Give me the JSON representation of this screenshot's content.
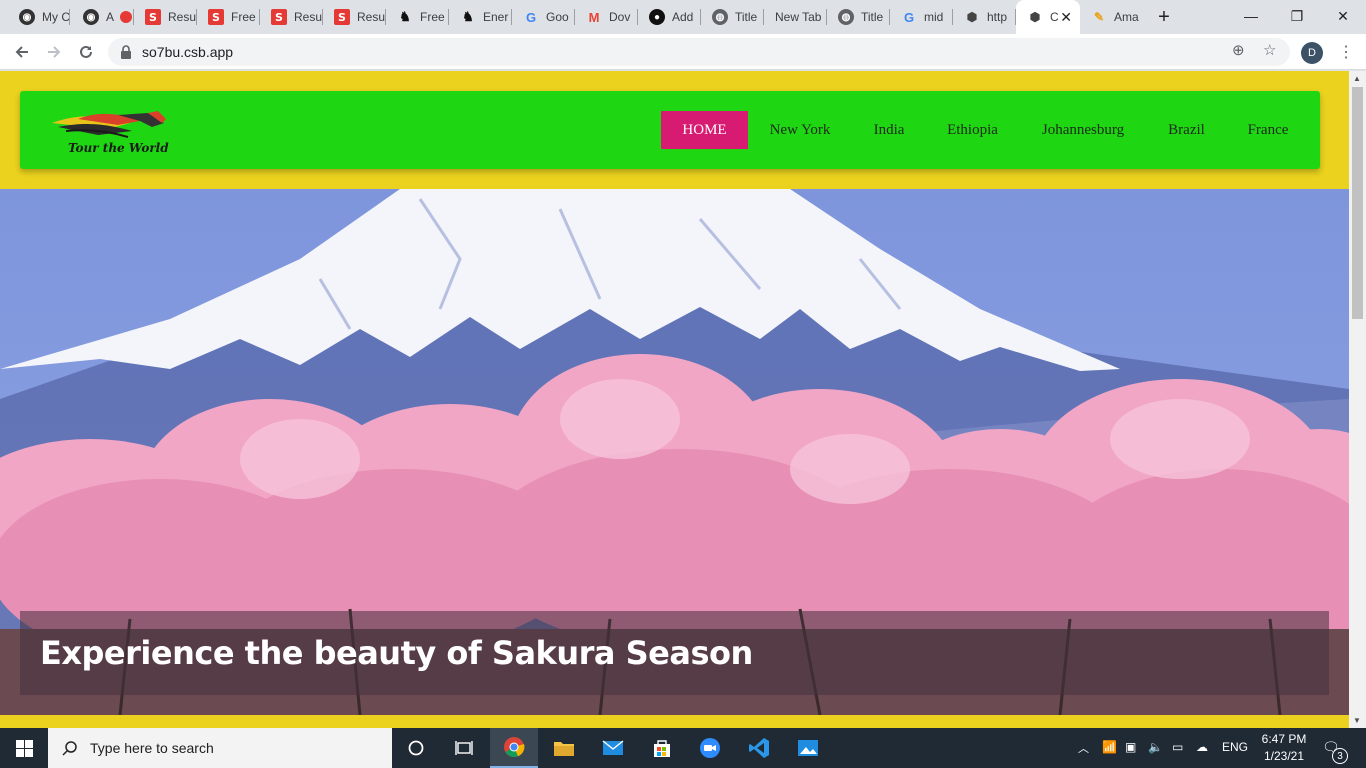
{
  "browser": {
    "tabs": [
      {
        "title": "My C",
        "favicon": "codesandbox-dark-icon"
      },
      {
        "title": "A",
        "favicon": "recording-icon"
      },
      {
        "title": "Resu",
        "favicon": "s-logo-icon"
      },
      {
        "title": "Free",
        "favicon": "s-logo-icon"
      },
      {
        "title": "Resu",
        "favicon": "s-logo-icon"
      },
      {
        "title": "Resu",
        "favicon": "s-logo-icon"
      },
      {
        "title": "Free",
        "favicon": "dark-horse-icon"
      },
      {
        "title": "Ener",
        "favicon": "dark-horse-icon"
      },
      {
        "title": "Goo",
        "favicon": "google-icon"
      },
      {
        "title": "Dov",
        "favicon": "gmail-icon"
      },
      {
        "title": "Add",
        "favicon": "github-icon"
      },
      {
        "title": "Title",
        "favicon": "globe-icon"
      },
      {
        "title": "New Tab",
        "favicon": ""
      },
      {
        "title": "Title",
        "favicon": "globe-icon"
      },
      {
        "title": "mid",
        "favicon": "google-icon"
      },
      {
        "title": "http",
        "favicon": "codesandbox-icon"
      },
      {
        "title": "C",
        "favicon": "codesandbox-icon",
        "active": true
      },
      {
        "title": "Ama",
        "favicon": "pencil-icon"
      }
    ],
    "new_tab_symbol": "+",
    "window_controls": {
      "minimize": "—",
      "maximize": "❐",
      "close": "✕"
    },
    "url": "so7bu.csb.app",
    "profile_initial": "D"
  },
  "site": {
    "logo_text": "Tour the World",
    "nav": [
      {
        "label": "HOME",
        "active": true
      },
      {
        "label": "New York"
      },
      {
        "label": "India"
      },
      {
        "label": "Ethiopia"
      },
      {
        "label": "Johannesburg"
      },
      {
        "label": "Brazil"
      },
      {
        "label": "France"
      }
    ],
    "hero_caption": "Experience the beauty of Sakura Season",
    "colors": {
      "page_background": "#ead21e",
      "navbar": "#1fd612",
      "active_nav": "#d81b72"
    }
  },
  "taskbar": {
    "search_placeholder": "Type here to search",
    "time": "6:47 PM",
    "date": "1/23/21",
    "language": "ENG",
    "notification_count": "3",
    "pinned": [
      "cortana-icon",
      "task-view-icon",
      "chrome-icon",
      "file-explorer-icon",
      "mail-icon",
      "store-icon",
      "zoom-icon",
      "vscode-icon",
      "photos-icon"
    ]
  }
}
